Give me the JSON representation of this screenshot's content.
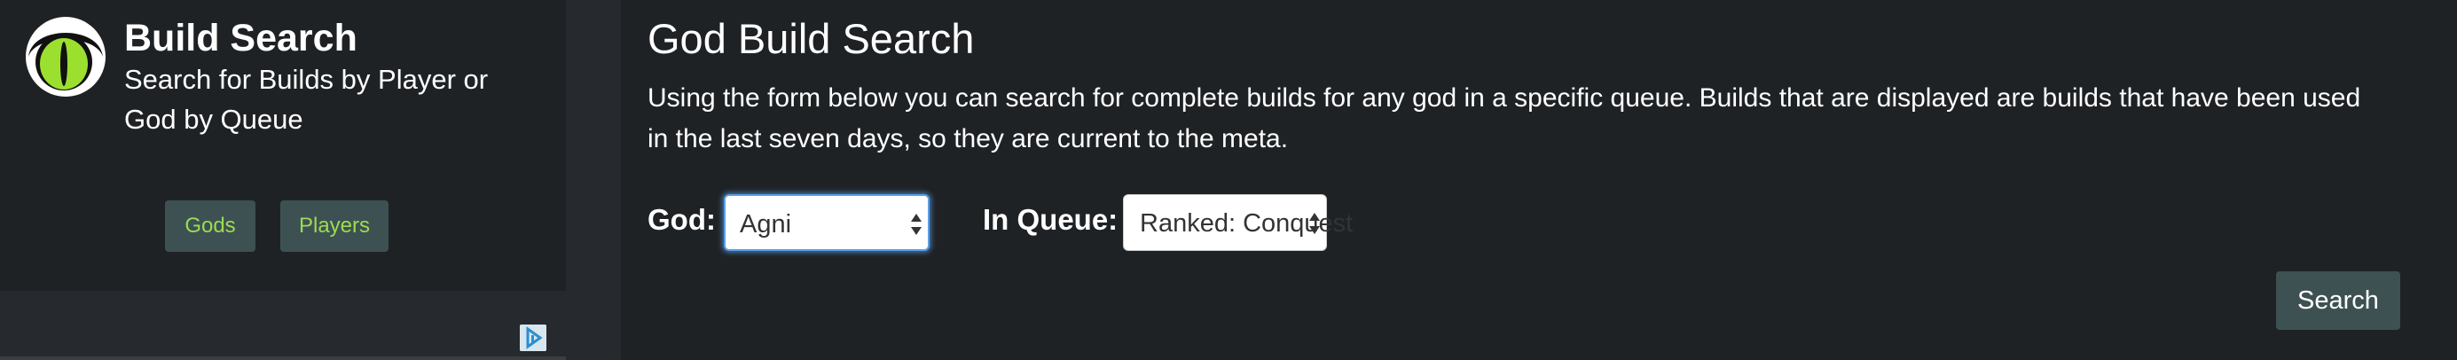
{
  "sidebar": {
    "title": "Build Search",
    "subtitle": "Search for Builds by Player or God by Queue",
    "buttons": {
      "gods": "Gods",
      "players": "Players"
    }
  },
  "main": {
    "title": "God Build Search",
    "description": "Using the form below you can search for complete builds for any god in a specific queue. Builds that are displayed are builds that have been used in the last seven days, so they are current to the meta.",
    "god_label": "God:",
    "god_selected": "Agni",
    "queue_label": "In Queue:",
    "queue_selected": "Ranked: Conquest",
    "search_button": "Search"
  },
  "icons": {
    "logo": "cat-eye-logo-icon",
    "ad": "adchoices-icon",
    "select_arrows": "select-arrows-icon"
  },
  "colors": {
    "background": "#26292d",
    "panel": "#1f2225",
    "button": "#3e5152",
    "button_text_accent": "#9bdb54",
    "focus_ring": "#5aa0e6"
  }
}
